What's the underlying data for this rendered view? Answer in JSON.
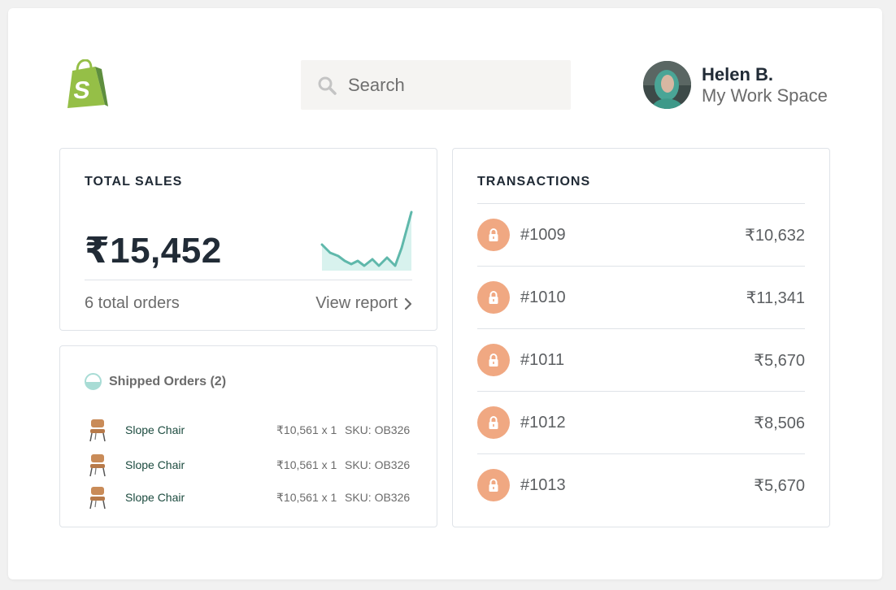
{
  "header": {
    "search_placeholder": "Search",
    "user": {
      "name": "Helen B.",
      "workspace": "My Work Space"
    }
  },
  "sales": {
    "title": "TOTAL SALES",
    "value": "₹15,452",
    "orders": "6 total orders",
    "view_report": "View report",
    "accent": "#5fb8ab"
  },
  "shipped": {
    "title": "Shipped Orders (2)",
    "items": [
      {
        "name": "Slope Chair",
        "price": "₹10,561 x 1",
        "sku": "SKU: OB326"
      },
      {
        "name": "Slope Chair",
        "price": "₹10,561 x 1",
        "sku": "SKU: OB326"
      },
      {
        "name": "Slope Chair",
        "price": "₹10,561 x 1",
        "sku": "SKU: OB326"
      }
    ]
  },
  "transactions": {
    "title": "TRANSACTIONS",
    "lock_color": "#f0a882",
    "rows": [
      {
        "id": "#1009",
        "amount": "₹10,632"
      },
      {
        "id": "#1010",
        "amount": "₹11,341"
      },
      {
        "id": "#1011",
        "amount": "₹5,670"
      },
      {
        "id": "#1012",
        "amount": "₹8,506"
      },
      {
        "id": "#1013",
        "amount": "₹5,670"
      }
    ]
  },
  "icons": {
    "logo": "shopify-bag-icon",
    "search": "search-icon",
    "chevron": "chevron-right-icon",
    "status": "half-circle-status-icon",
    "product": "chair-icon",
    "lock": "lock-icon"
  }
}
